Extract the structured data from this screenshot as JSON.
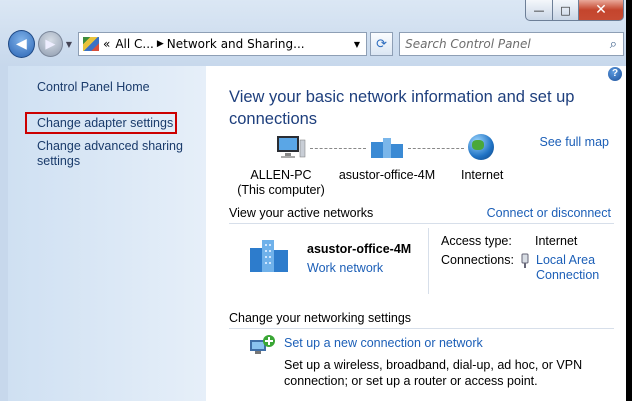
{
  "window": {
    "caption_controls": {
      "minimize": "—",
      "maximize": "□",
      "close": "✕"
    }
  },
  "navigation": {
    "breadcrumb": [
      "All C...",
      "Network and Sharing..."
    ],
    "breadcrumb_prefix": "«",
    "search_placeholder": "Search Control Panel"
  },
  "sidebar": {
    "home": "Control Panel Home",
    "adapter": "Change adapter settings",
    "sharing": "Change advanced sharing settings"
  },
  "main": {
    "title": "View your basic network information and set up connections",
    "see_full_map": "See full map",
    "map": {
      "computer_name": "ALLEN-PC",
      "computer_sub": "(This computer)",
      "network": "asustor-office-4M",
      "internet": "Internet"
    },
    "active_networks": {
      "heading": "View your active networks",
      "connect_link": "Connect or disconnect",
      "network_name": "asustor-office-4M",
      "network_type": "Work network",
      "access_label": "Access type:",
      "access_value": "Internet",
      "connections_label": "Connections:",
      "connections_value": "Local Area Connection"
    },
    "settings": {
      "heading": "Change your networking settings",
      "task_link": "Set up a new connection or network",
      "task_desc": "Set up a wireless, broadband, dial-up, ad hoc, or VPN connection; or set up a router or access point."
    }
  }
}
